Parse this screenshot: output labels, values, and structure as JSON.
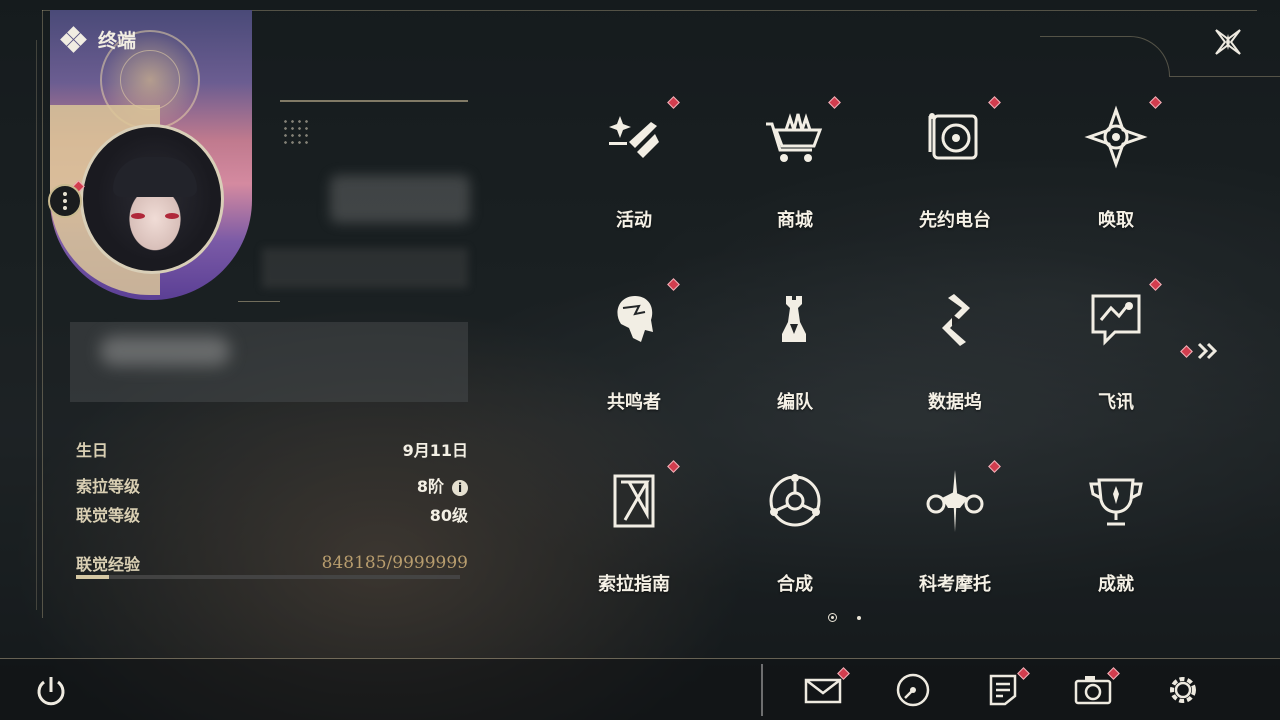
{
  "header": {
    "title": "终端"
  },
  "profile": {
    "stats": [
      {
        "label": "生日",
        "value": "9月11日"
      },
      {
        "label": "索拉等级",
        "value": "8阶",
        "info_icon": "i"
      },
      {
        "label": "联觉等级",
        "value": "80级"
      }
    ],
    "exp": {
      "label": "联觉经验",
      "value": "848185/9999999",
      "progress": 0.085
    }
  },
  "menu": {
    "items": [
      {
        "label": "活动",
        "icon": "sparkle-activity-icon",
        "badge": true
      },
      {
        "label": "商城",
        "icon": "shop-cart-icon",
        "badge": true
      },
      {
        "label": "先约电台",
        "icon": "radio-turntable-icon",
        "badge": true
      },
      {
        "label": "唤取",
        "icon": "compass-star-icon",
        "badge": true
      },
      {
        "label": "共鸣者",
        "icon": "resonator-head-icon",
        "badge": true
      },
      {
        "label": "编队",
        "icon": "chess-team-icon",
        "badge": false
      },
      {
        "label": "数据坞",
        "icon": "data-dock-icon",
        "badge": false
      },
      {
        "label": "飞讯",
        "icon": "message-chat-icon",
        "badge": true
      },
      {
        "label": "索拉指南",
        "icon": "guide-book-icon",
        "badge": true
      },
      {
        "label": "合成",
        "icon": "synthesis-orbit-icon",
        "badge": false
      },
      {
        "label": "科考摩托",
        "icon": "motorbike-icon",
        "badge": true
      },
      {
        "label": "成就",
        "icon": "trophy-icon",
        "badge": false
      }
    ]
  },
  "pagination": {
    "current": 1,
    "total": 2
  },
  "bottom_bar": {
    "icons": [
      "power-icon",
      "mail-icon",
      "clock-dial-icon",
      "notice-note-icon",
      "camera-icon",
      "settings-gear-icon"
    ]
  },
  "colors": {
    "badge": "#d23d4e",
    "accent": "#c8b98f",
    "exp_text": "#b89d6e"
  }
}
